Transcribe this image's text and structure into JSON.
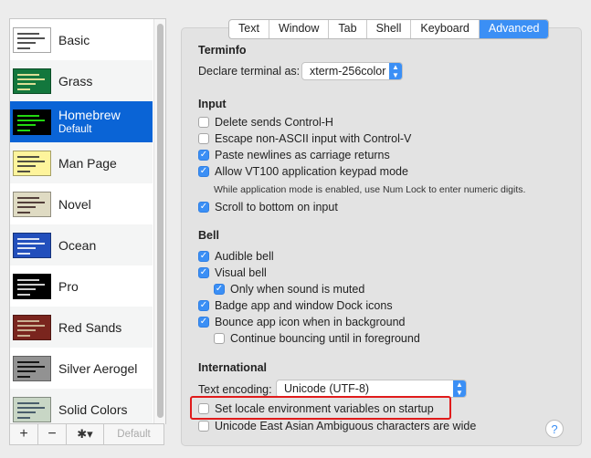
{
  "sidebar": {
    "profiles": [
      {
        "name": "Basic",
        "sub": "",
        "bg": "#ffffff",
        "fg": "#333333"
      },
      {
        "name": "Grass",
        "sub": "",
        "bg": "#13773d",
        "fg": "#fff0a5"
      },
      {
        "name": "Homebrew",
        "sub": "Default",
        "bg": "#000000",
        "fg": "#28fe14"
      },
      {
        "name": "Man Page",
        "sub": "",
        "bg": "#fef49c",
        "fg": "#333333"
      },
      {
        "name": "Novel",
        "sub": "",
        "bg": "#dfdbc3",
        "fg": "#3b2322"
      },
      {
        "name": "Ocean",
        "sub": "",
        "bg": "#224fbc",
        "fg": "#ffffff"
      },
      {
        "name": "Pro",
        "sub": "",
        "bg": "#000000",
        "fg": "#f2f2f2"
      },
      {
        "name": "Red Sands",
        "sub": "",
        "bg": "#7a251e",
        "fg": "#d7c9a7"
      },
      {
        "name": "Silver Aerogel",
        "sub": "",
        "bg": "#929292",
        "fg": "#000000"
      },
      {
        "name": "Solid Colors",
        "sub": "",
        "bg": "#c8d6c5",
        "fg": "#33485b"
      }
    ],
    "selected_index": 2,
    "toolbar": {
      "add": "+",
      "remove": "−",
      "gear": "✱▾",
      "default": "Default"
    }
  },
  "tabs": [
    "Text",
    "Window",
    "Tab",
    "Shell",
    "Keyboard",
    "Advanced"
  ],
  "active_tab": "Advanced",
  "terminfo": {
    "title": "Terminfo",
    "declare_label": "Declare terminal as:",
    "declare_value": "xterm-256color"
  },
  "input": {
    "title": "Input",
    "options": [
      {
        "label": "Delete sends Control-H",
        "checked": false
      },
      {
        "label": "Escape non-ASCII input with Control-V",
        "checked": false
      },
      {
        "label": "Paste newlines as carriage returns",
        "checked": true
      },
      {
        "label": "Allow VT100 application keypad mode",
        "checked": true
      }
    ],
    "note": "While application mode is enabled, use Num Lock to enter numeric digits.",
    "scroll_option": {
      "label": "Scroll to bottom on input",
      "checked": true
    }
  },
  "bell": {
    "title": "Bell",
    "audible": {
      "label": "Audible bell",
      "checked": true
    },
    "visual": {
      "label": "Visual bell",
      "checked": true
    },
    "only_muted": {
      "label": "Only when sound is muted",
      "checked": true
    },
    "badge": {
      "label": "Badge app and window Dock icons",
      "checked": true
    },
    "bounce": {
      "label": "Bounce app icon when in background",
      "checked": true
    },
    "continue_bounce": {
      "label": "Continue bouncing until in foreground",
      "checked": false
    }
  },
  "international": {
    "title": "International",
    "encoding_label": "Text encoding:",
    "encoding_value": "Unicode (UTF-8)",
    "locale": {
      "label": "Set locale environment variables on startup",
      "checked": false
    },
    "east_asian": {
      "label": "Unicode East Asian Ambiguous characters are wide",
      "checked": false
    }
  },
  "help": "?",
  "colors": {
    "accent": "#3b8ff5",
    "selection": "#0a64d6",
    "highlight": "#e01b1b"
  }
}
